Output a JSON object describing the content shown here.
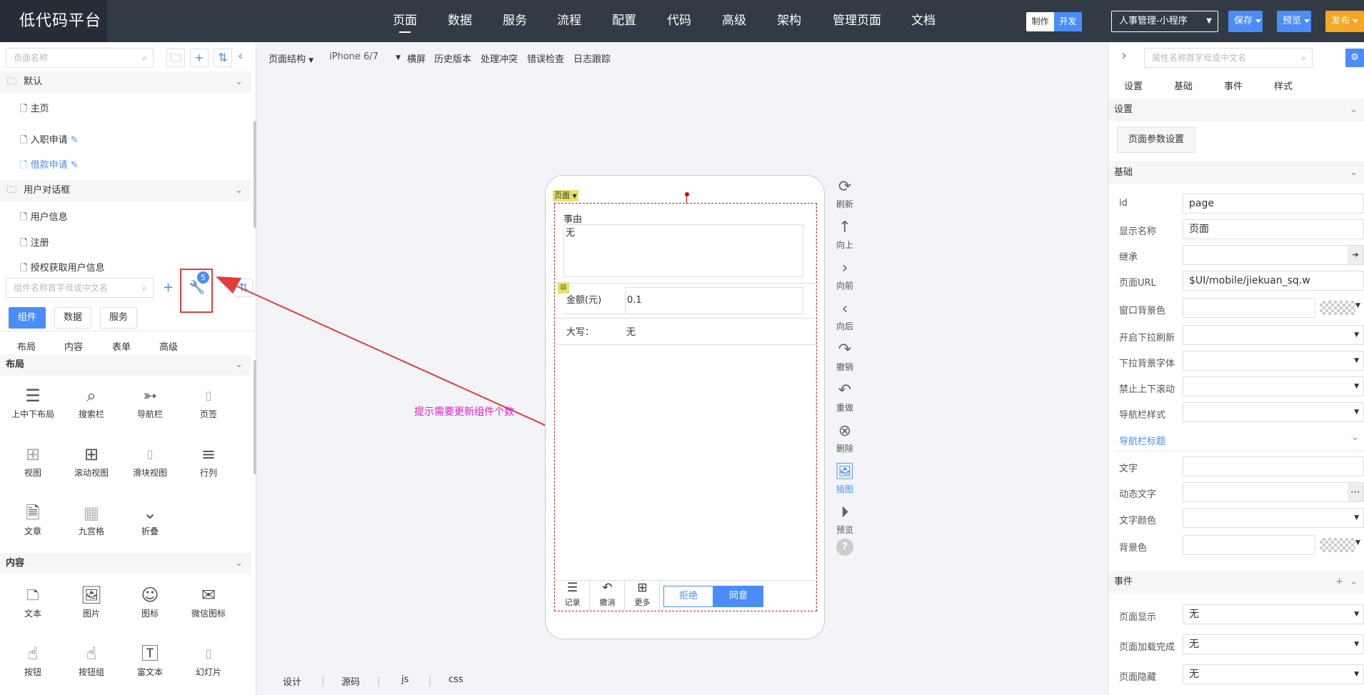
{
  "app": {
    "title": "低代码平台"
  },
  "nav": [
    "页面",
    "数据",
    "服务",
    "流程",
    "配置",
    "代码",
    "高级",
    "架构",
    "管理页面",
    "文档"
  ],
  "mode": {
    "make": "制作",
    "dev": "开发"
  },
  "app_select": "人事管理-小程序",
  "toolbar": {
    "save": "保存",
    "preview": "预览",
    "publish": "发布"
  },
  "left": {
    "page_search_placeholder": "页面名称",
    "groups": [
      {
        "name": "默认",
        "items": [
          "主页",
          "入职申请",
          "借款申请"
        ]
      },
      {
        "name": "用户对话框",
        "items": [
          "用户信息",
          "注册",
          "授权获取用户信息"
        ]
      }
    ],
    "comp_search_placeholder": "组件名称首字母或中文名",
    "update_badge": "5",
    "tabs": [
      "组件",
      "数据",
      "服务"
    ],
    "subtabs": [
      "布局",
      "内容",
      "表单",
      "高级"
    ],
    "sections": [
      {
        "name": "布局",
        "items": [
          "上中下布局",
          "搜索栏",
          "导航栏",
          "页签",
          "视图",
          "滚动视图",
          "滑块视图",
          "行列",
          "文章",
          "九宫格",
          "折叠"
        ]
      },
      {
        "name": "内容",
        "items": [
          "文本",
          "图片",
          "图标",
          "微信图标",
          "按钮",
          "按钮组",
          "富文本",
          "幻灯片"
        ]
      }
    ]
  },
  "canvas": {
    "tools": [
      "页面结构",
      "iPhone 6/7",
      "横屏",
      "历史版本",
      "处理冲突",
      "错误检查",
      "日志跟踪"
    ],
    "annotation": "提示需要更新组件个数",
    "page_tag": "页面",
    "form": {
      "reason_label": "事由",
      "reason_value": "无",
      "amount_label": "金额(元)",
      "amount_value": "0.1",
      "upper_label": "大写：",
      "upper_value": "无"
    },
    "footer": {
      "record": "记录",
      "revoke": "撤消",
      "more": "更多",
      "reject": "拒绝",
      "agree": "同意"
    },
    "side": [
      "刷新",
      "向上",
      "向前",
      "向后",
      "撤销",
      "重做",
      "删除",
      "插图",
      "预览"
    ],
    "bottom_tabs": [
      "设计",
      "源码",
      "js",
      "css"
    ]
  },
  "right": {
    "search_placeholder": "属性名称首字母或中文名",
    "tabs": [
      "设置",
      "基础",
      "事件",
      "样式"
    ],
    "settings_title": "设置",
    "page_param_btn": "页面参数设置",
    "basic_title": "基础",
    "fields": [
      {
        "label": "id",
        "value": "page"
      },
      {
        "label": "显示名称",
        "value": "页面"
      },
      {
        "label": "继承",
        "value": ""
      },
      {
        "label": "页面URL",
        "value": "$UI/mobile/jiekuan_sq.w"
      },
      {
        "label": "窗口背景色",
        "value": ""
      },
      {
        "label": "开启下拉刷新",
        "value": ""
      },
      {
        "label": "下拉背景字体",
        "value": ""
      },
      {
        "label": "禁止上下滚动",
        "value": ""
      },
      {
        "label": "导航栏样式",
        "value": ""
      }
    ],
    "navbar_title": "导航栏标题",
    "navbar_fields": [
      {
        "label": "文字",
        "value": ""
      },
      {
        "label": "动态文字",
        "value": ""
      },
      {
        "label": "文字颜色",
        "value": ""
      },
      {
        "label": "背景色",
        "value": ""
      }
    ],
    "events_title": "事件",
    "events": [
      {
        "label": "页面显示",
        "value": "无"
      },
      {
        "label": "页面加载完成",
        "value": "无"
      },
      {
        "label": "页面隐藏",
        "value": "无"
      }
    ]
  },
  "colors": {
    "topbar": "#323a45",
    "accent": "#4b8df8",
    "publish": "#f5a623",
    "annotation": "#e63b3b",
    "annotation_text": "#e020c0"
  }
}
